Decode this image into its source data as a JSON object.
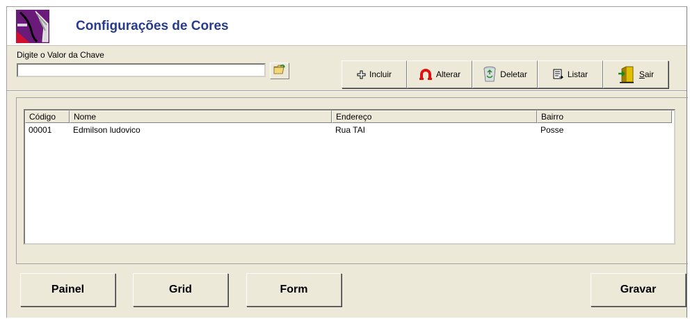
{
  "header": {
    "title": "Configurações de Cores",
    "icon": "app-logo-icon"
  },
  "search": {
    "label": "Digite o Valor da Chave",
    "value": "",
    "placeholder": "",
    "open_icon": "folder-open-icon"
  },
  "toolbar": {
    "incluir": {
      "label": "Incluir",
      "icon": "plus-icon"
    },
    "alterar": {
      "label": "Alterar",
      "icon": "horseshoe-icon"
    },
    "deletar": {
      "label": "Deletar",
      "icon": "recycle-bin-icon"
    },
    "listar": {
      "label": "Listar",
      "icon": "list-document-icon"
    },
    "sair": {
      "label_accel": "S",
      "label_rest": "air",
      "icon": "exit-door-icon"
    }
  },
  "table": {
    "columns": [
      "Código",
      "Nome",
      "Endereço",
      "Bairro"
    ],
    "rows": [
      {
        "codigo": "00001",
        "nome": "Edmilson ludovico",
        "endereco": "Rua TAI",
        "bairro": "Posse"
      }
    ]
  },
  "bottom": {
    "painel": "Painel",
    "grid": "Grid",
    "form": "Form",
    "gravar": "Gravar"
  },
  "colors": {
    "title": "#283c8c",
    "face": "#ece9d8",
    "logo_bg": "#6a1b7a"
  }
}
